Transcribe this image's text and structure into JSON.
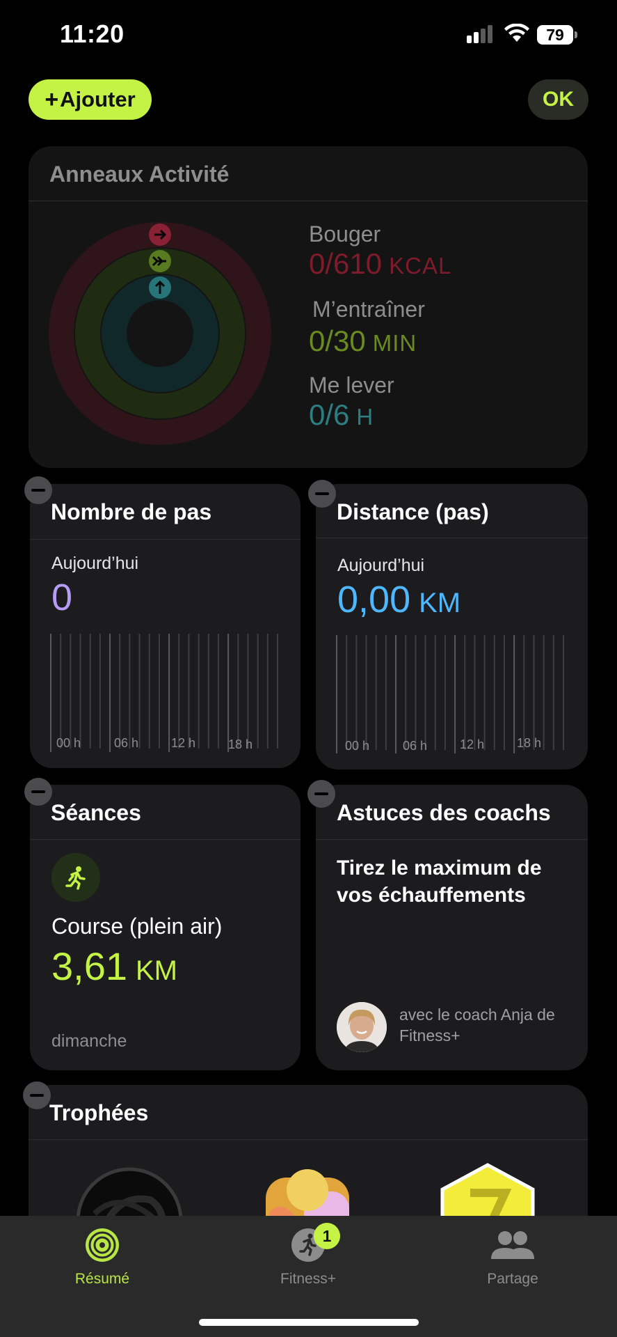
{
  "status_bar": {
    "time": "11:20",
    "battery": "79"
  },
  "header": {
    "add_label": "Ajouter",
    "add_plus": "+",
    "ok_label": "OK"
  },
  "activity": {
    "title": "Anneaux Activité",
    "move": {
      "label": "Bouger",
      "value": "0/610",
      "unit": "KCAL",
      "color": "#ff375f"
    },
    "exercise": {
      "label": "M’entraîner",
      "value": "0/30",
      "unit": "MIN",
      "color": "#b3e53e"
    },
    "stand": {
      "label": "Me lever",
      "value": "0/6",
      "unit": "H",
      "color": "#3ed7dd"
    }
  },
  "steps": {
    "title": "Nombre de pas",
    "sub": "Aujourd’hui",
    "value": "0",
    "ticks": [
      "00 h",
      "06 h",
      "12 h",
      "18 h"
    ],
    "color": "#b69cf5"
  },
  "distance": {
    "title": "Distance (pas)",
    "sub": "Aujourd’hui",
    "value": "0,00",
    "unit": "KM",
    "ticks": [
      "00 h",
      "06 h",
      "12 h",
      "18 h"
    ],
    "color": "#4fb7ff"
  },
  "sessions": {
    "title": "Séances",
    "type": "Course (plein air)",
    "value": "3,61",
    "unit": "KM",
    "day": "dimanche",
    "color": "#c4f345"
  },
  "tips": {
    "title": "Astuces des coachs",
    "headline": "Tirez le maximum de vos échauffements",
    "coach": "avec le coach Anja de Fitness+"
  },
  "trophies": {
    "title": "Trophées"
  },
  "tab_bar": {
    "items": [
      {
        "label": "Résumé",
        "icon": "rings-icon"
      },
      {
        "label": "Fitness+",
        "icon": "runner-icon",
        "badge": "1"
      },
      {
        "label": "Partage",
        "icon": "people-icon"
      }
    ]
  }
}
